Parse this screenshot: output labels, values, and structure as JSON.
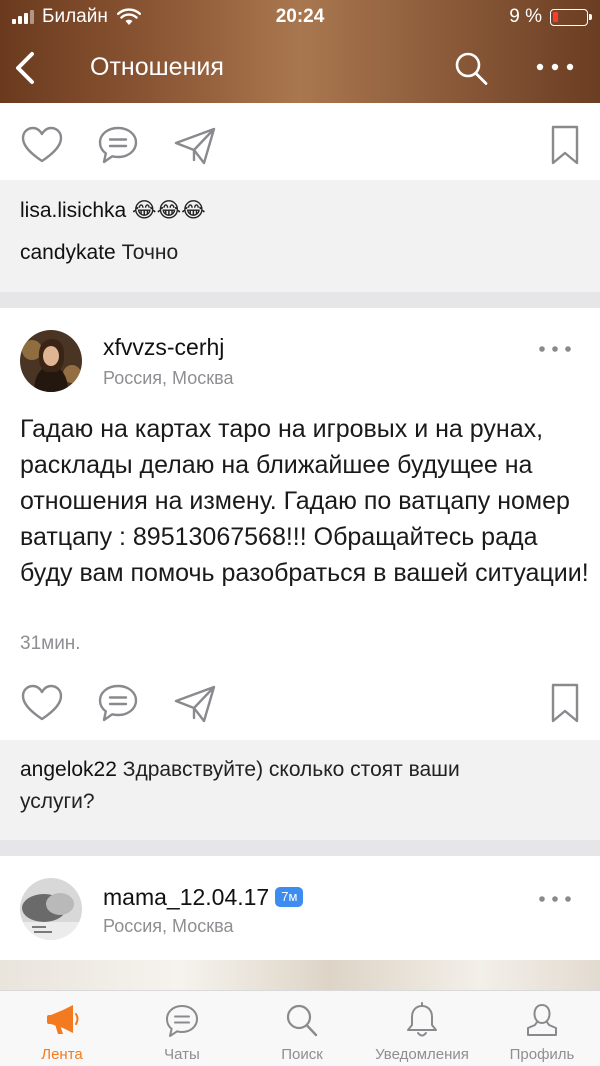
{
  "status_bar": {
    "carrier": "Билайн",
    "time": "20:24",
    "battery_percent": "9 %",
    "battery_level": 0.09
  },
  "nav": {
    "title": "Отношения",
    "back_icon": "chevron-left-icon",
    "search_icon": "search-icon",
    "more_icon": "more-horizontal-icon"
  },
  "top_comments": [
    {
      "user": "lisa.lisichka",
      "text": "😂😂😂"
    },
    {
      "user": "candykate",
      "text": "Точно"
    }
  ],
  "post": {
    "author": "xfvvzs-cerhj",
    "location": "Россия, Москва",
    "text": "Гадаю на картах таро на игровых и на рунах, расклады делаю на ближайшее будущее на отношения на измену. Гадаю по ватцапу номер ватцапу : 89513067568!!! Обращайтесь рада буду вам помочь разобраться в вашей ситуации!",
    "time": "31мин.",
    "comments": [
      {
        "user": "angelok22",
        "text": "Здравствуйте) сколько стоят ваши услуги?"
      }
    ]
  },
  "next_post": {
    "author": "mama_12.04.17",
    "badge": "7м",
    "location": "Россия, Москва"
  },
  "tabs": [
    {
      "label": "Лента",
      "icon": "megaphone-icon",
      "active": true
    },
    {
      "label": "Чаты",
      "icon": "chat-bubble-icon",
      "active": false
    },
    {
      "label": "Поиск",
      "icon": "search-icon",
      "active": false
    },
    {
      "label": "Уведомления",
      "icon": "bell-icon",
      "active": false
    },
    {
      "label": "Профиль",
      "icon": "person-icon",
      "active": false
    }
  ],
  "colors": {
    "accent": "#f47a20",
    "badge": "#3d8df0",
    "muted_text": "#8e8e93",
    "icon_gray": "#8a8a8e"
  }
}
